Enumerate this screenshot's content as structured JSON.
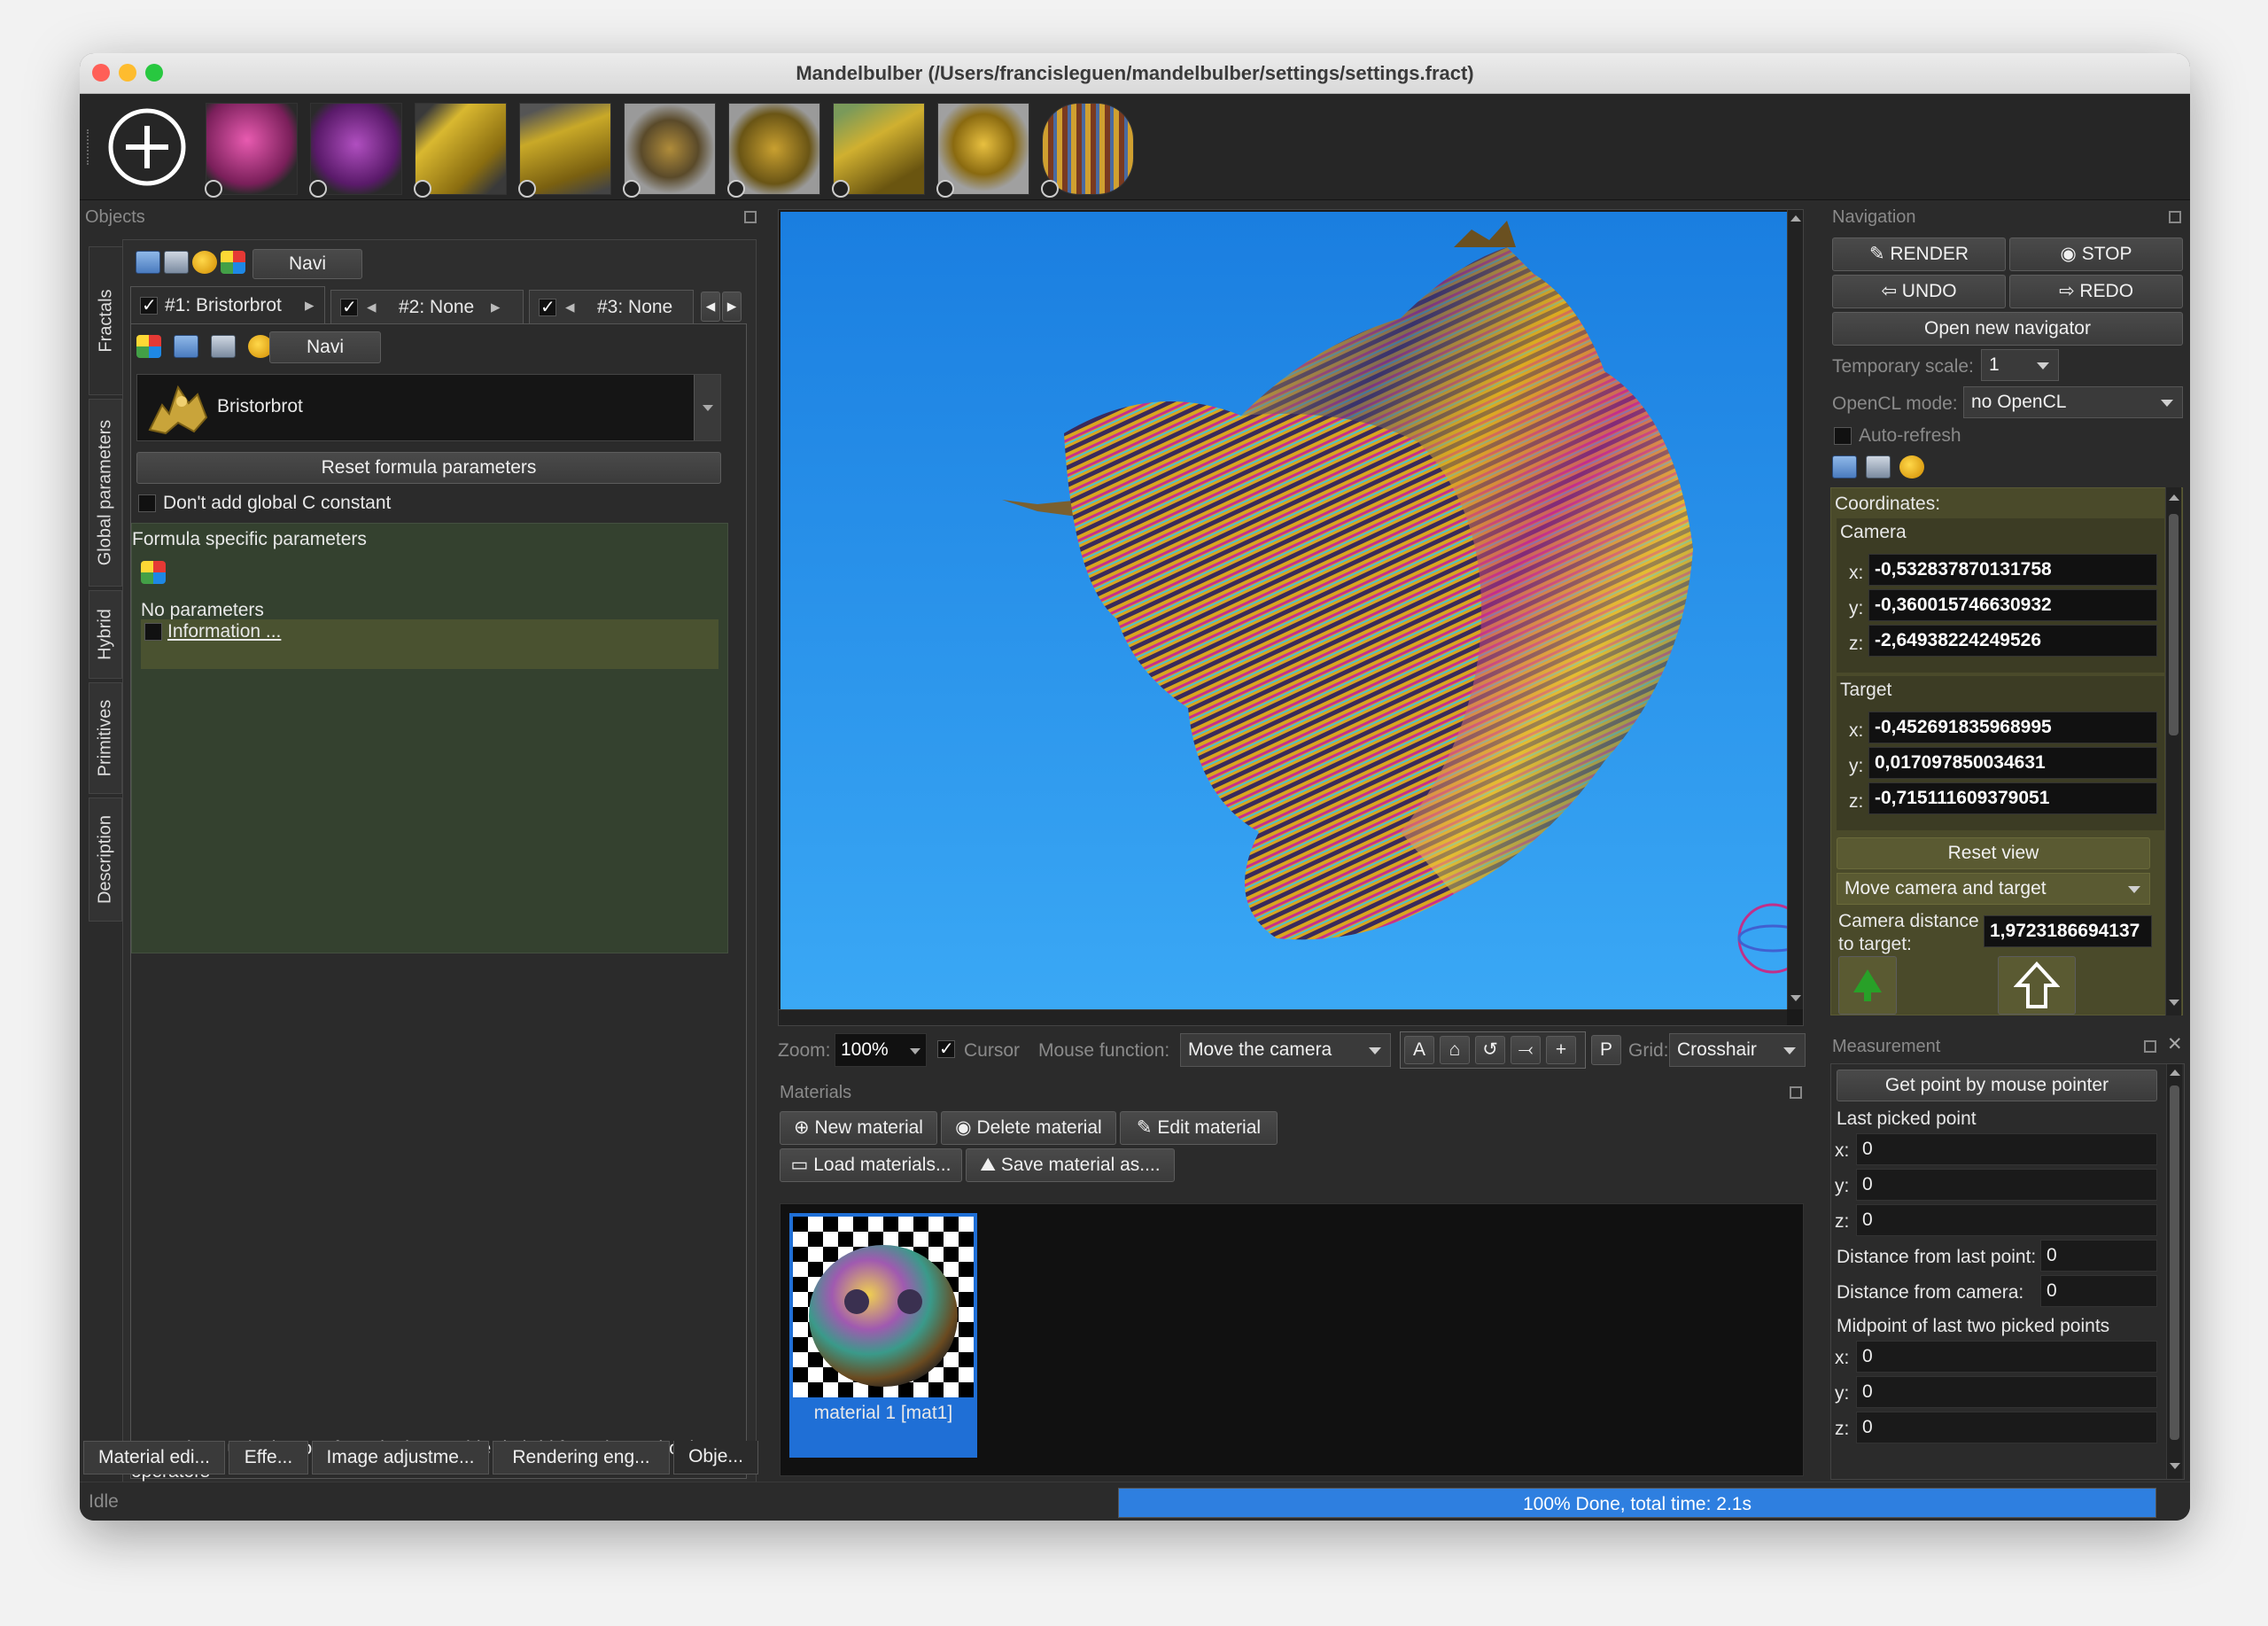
{
  "window": {
    "title": "Mandelbulber (/Users/francisleguen/mandelbulber/settings/settings.fract)"
  },
  "status": {
    "left": "Idle",
    "progress_text": "100% Done, total time: 2.1s",
    "progress": 1.0
  },
  "objects": {
    "title": "Objects",
    "side_tabs": [
      "Fractals",
      "Global parameters",
      "Hybrid",
      "Primitives",
      "Description"
    ],
    "navi_label": "Navi",
    "formula_tabs": [
      "#1: Bristorbrot",
      "#2: None",
      "#3: None"
    ],
    "formula_name": "Bristorbrot",
    "reset_button": "Reset formula parameters",
    "dont_add_c": "Don't add global C constant",
    "formula_specific": "Formula specific parameters",
    "no_parameters": "No parameters",
    "information": "Information ...",
    "remark": "Remark: to unlock more fractal tabs, enable \"hybrid fractals\" or \"boolean operators\""
  },
  "bottom_tabs": [
    "Material edi...",
    "Effe...",
    "Image adjustme...",
    "Rendering eng...",
    "Obje..."
  ],
  "viewport_toolbar": {
    "zoom_label": "Zoom:",
    "zoom_value": "100%",
    "cursor_label": "Cursor",
    "mouse_function_label": "Mouse function:",
    "mouse_function_value": "Move the camera",
    "grid_label": "Grid:",
    "grid_value": "Crosshair",
    "tool_letters": [
      "A",
      "P"
    ]
  },
  "materials": {
    "title": "Materials",
    "new": "New material",
    "delete": "Delete material",
    "edit": "Edit material",
    "load": "Load materials...",
    "save": "Save material as....",
    "items": [
      {
        "label": "material 1 [mat1]"
      }
    ]
  },
  "navigation": {
    "title": "Navigation",
    "render": "RENDER",
    "stop": "STOP",
    "undo": "UNDO",
    "redo": "REDO",
    "open_navigator": "Open new navigator",
    "temp_scale_label": "Temporary scale:",
    "temp_scale_value": "1",
    "opencl_label": "OpenCL mode:",
    "opencl_value": "no OpenCL",
    "auto_refresh": "Auto-refresh",
    "coordinates_label": "Coordinates:",
    "camera_label": "Camera",
    "camera": {
      "x": "-0,532837870131758",
      "y": "-0,360015746630932",
      "z": "-2,64938224249526"
    },
    "target_label": "Target",
    "target": {
      "x": "-0,452691835968995",
      "y": "0,017097850034631",
      "z": "-0,715111609379051"
    },
    "axis_labels": [
      "x:",
      "y:",
      "z:"
    ],
    "reset_view": "Reset view",
    "move_mode": "Move camera and target",
    "camera_distance_label": "Camera distance to target:",
    "camera_distance_value": "1,9723186694137"
  },
  "measurement": {
    "title": "Measurement",
    "get_point": "Get point by mouse pointer",
    "last_picked": "Last picked point",
    "last": {
      "x": "0",
      "y": "0",
      "z": "0"
    },
    "dist_last_label": "Distance from last point:",
    "dist_last": "0",
    "dist_camera_label": "Distance from camera:",
    "dist_camera": "0",
    "midpoint_label": "Midpoint of last two picked points",
    "mid": {
      "x": "0",
      "y": "0",
      "z": "0"
    }
  },
  "colors": {
    "background_sky": "#2a8fe6",
    "panel": "#2b2b2b",
    "green_panel": "#34412f",
    "olive_panel": "#4a4a2a",
    "progress": "#2e7fe0",
    "selection": "#1f6fd6"
  }
}
